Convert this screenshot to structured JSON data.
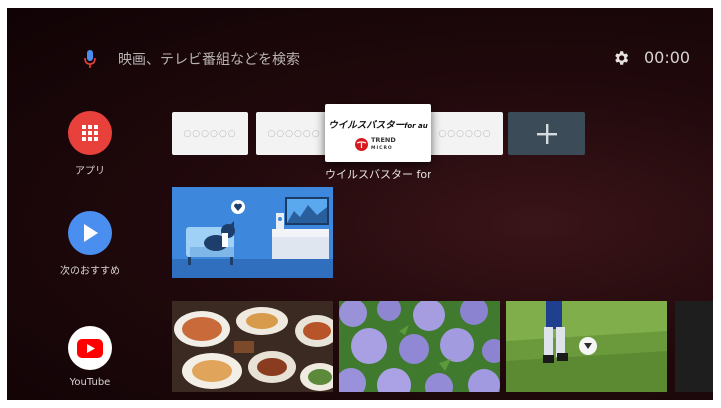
{
  "search": {
    "placeholder_text": "映画、テレビ番組などを検索",
    "icon": "mic-icon"
  },
  "clock": {
    "time": "00:00"
  },
  "settings": {
    "icon": "gear-icon"
  },
  "sidebar": {
    "items": [
      {
        "label": "アプリ",
        "icon": "apps-grid-icon",
        "color": "#e8413b"
      },
      {
        "label": "次のおすすめ",
        "icon": "play-icon",
        "color": "#4a8ff0"
      },
      {
        "label": "YouTube",
        "icon": "youtube-icon",
        "color": "#ffffff"
      }
    ]
  },
  "apps_row": {
    "tiles": [
      {
        "placeholder": "○○○○○○"
      },
      {
        "placeholder": "○○○○○○"
      },
      {
        "placeholder": "○○○○○○"
      }
    ],
    "focused": {
      "title_main": "ウイルスバスター",
      "title_sub": "for au",
      "logo_text": "TREND",
      "logo_subtext": "MICRO",
      "caption": "ウイルスバスター for au"
    },
    "add_button": {
      "label": "+"
    }
  },
  "recommend_row": {
    "card": "illustration-dog-tv"
  },
  "youtube_row": {
    "cards": [
      "food-photo",
      "hydrangea-photo",
      "soccer-photo",
      "dark-photo"
    ]
  },
  "colors": {
    "accent_red": "#e8413b",
    "accent_blue": "#4a8ff0",
    "add_tile": "#3b4c58"
  }
}
